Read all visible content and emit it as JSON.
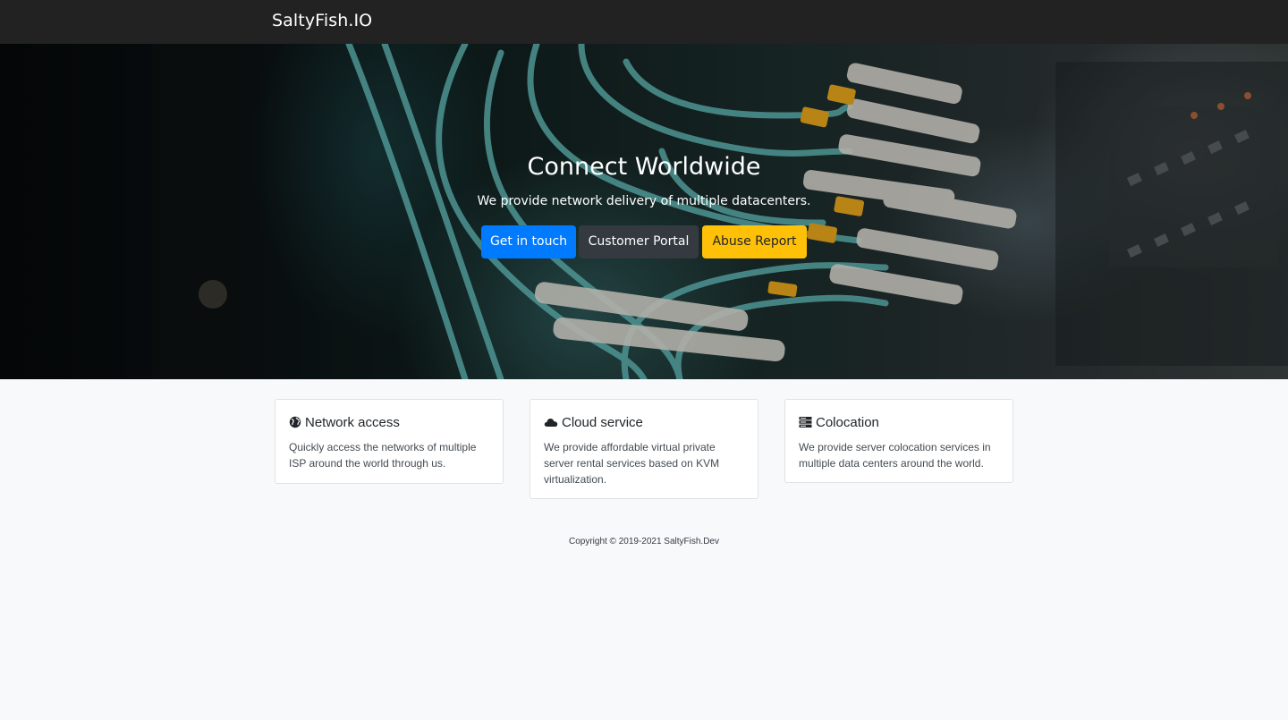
{
  "navbar": {
    "brand": "SaltyFish.IO"
  },
  "hero": {
    "title": "Connect Worldwide",
    "subtitle": "We provide network delivery of multiple datacenters.",
    "buttons": [
      {
        "label": "Get in touch",
        "color": "#007bff"
      },
      {
        "label": "Customer Portal",
        "color": "#343a40"
      },
      {
        "label": "Abuse Report",
        "color": "#ffc107"
      }
    ]
  },
  "features": [
    {
      "icon": "globe-icon",
      "title": "Network access",
      "text": "Quickly access the networks of multiple ISP around the world through us."
    },
    {
      "icon": "cloud-icon",
      "title": "Cloud service",
      "text": "We provide affordable virtual private server rental services based on KVM virtualization."
    },
    {
      "icon": "server-icon",
      "title": "Colocation",
      "text": "We provide server colocation services in multiple data centers around the world."
    }
  ],
  "footer": {
    "copyright": "Copyright © 2019-2021 SaltyFish.Dev"
  }
}
